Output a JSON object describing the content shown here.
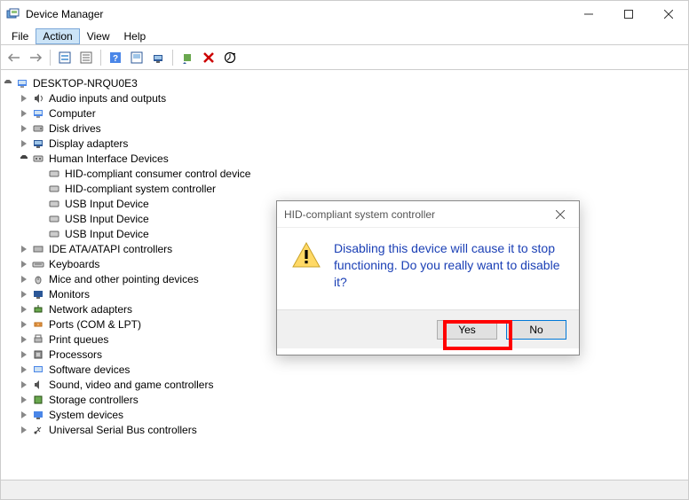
{
  "window": {
    "title": "Device Manager"
  },
  "menu": {
    "file": "File",
    "action": "Action",
    "view": "View",
    "help": "Help"
  },
  "tree": {
    "root": "DESKTOP-NRQU0E3",
    "nodes": [
      "Audio inputs and outputs",
      "Computer",
      "Disk drives",
      "Display adapters",
      "Human Interface Devices",
      "IDE ATA/ATAPI controllers",
      "Keyboards",
      "Mice and other pointing devices",
      "Monitors",
      "Network adapters",
      "Ports (COM & LPT)",
      "Print queues",
      "Processors",
      "Software devices",
      "Sound, video and game controllers",
      "Storage controllers",
      "System devices",
      "Universal Serial Bus controllers"
    ],
    "hid_children": [
      "HID-compliant consumer control device",
      "HID-compliant system controller",
      "USB Input Device",
      "USB Input Device",
      "USB Input Device"
    ]
  },
  "dialog": {
    "title": "HID-compliant system controller",
    "message": "Disabling this device will cause it to stop functioning. Do you really want to disable it?",
    "yes": "Yes",
    "no": "No"
  }
}
